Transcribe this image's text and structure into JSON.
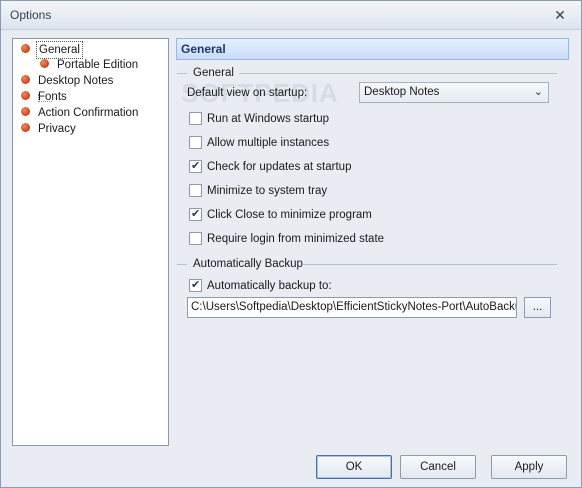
{
  "window": {
    "title": "Options",
    "close_glyph": "✕"
  },
  "tree": {
    "items": [
      {
        "label": "General",
        "selected": true,
        "level": 0
      },
      {
        "label": "Portable Edition",
        "selected": false,
        "level": 1
      },
      {
        "label": "Desktop Notes",
        "selected": false,
        "level": 0
      },
      {
        "label": "Fonts",
        "selected": false,
        "level": 0
      },
      {
        "label": "Action Confirmation",
        "selected": false,
        "level": 0
      },
      {
        "label": "Privacy",
        "selected": false,
        "level": 0
      }
    ]
  },
  "header": {
    "title": "General"
  },
  "general_group": {
    "title": "General",
    "default_view_label": "Default view on startup:",
    "default_view_value": "Desktop Notes",
    "checkboxes": [
      {
        "label": "Run at Windows startup",
        "checked": false
      },
      {
        "label": "Allow multiple instances",
        "checked": false
      },
      {
        "label": "Check for updates at startup",
        "checked": true
      },
      {
        "label": "Minimize to system tray",
        "checked": false
      },
      {
        "label": "Click Close to minimize program",
        "checked": true
      },
      {
        "label": "Require login from minimized state",
        "checked": false
      }
    ]
  },
  "backup_group": {
    "title": "Automatically Backup",
    "auto_backup_label": "Automatically backup to:",
    "auto_backup_checked": true,
    "path_value": "C:\\Users\\Softpedia\\Desktop\\EfficientStickyNotes-Port\\AutoBackup\\",
    "browse_label": "..."
  },
  "buttons": {
    "ok": "OK",
    "cancel": "Cancel",
    "apply": "Apply"
  },
  "watermark": "SOFTPEDIA"
}
